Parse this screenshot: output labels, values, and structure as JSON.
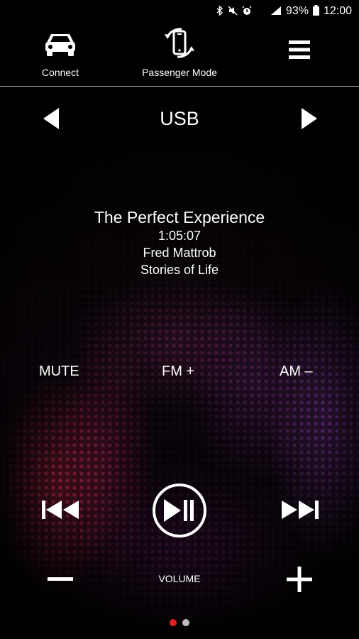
{
  "status_bar": {
    "bluetooth_icon": "bluetooth-icon",
    "mute_icon": "mute-icon",
    "alarm_icon": "alarm-icon",
    "signal_icon": "signal-icon",
    "battery": "93%",
    "time": "12:00"
  },
  "top_bar": {
    "connect_label": "Connect",
    "passenger_label": "Passenger Mode",
    "menu_icon": "hamburger-menu-icon"
  },
  "source": {
    "name": "USB"
  },
  "track": {
    "title": "The Perfect Experience",
    "time": "1:05:07",
    "artist": "Fred Mattrob",
    "album": "Stories of Life"
  },
  "presets": {
    "mute": "MUTE",
    "fm": "FM +",
    "am": "AM –"
  },
  "volume": {
    "label": "VOLUME"
  },
  "pages": {
    "active_color": "#e0201e",
    "inactive_color": "#bdbdbd"
  }
}
